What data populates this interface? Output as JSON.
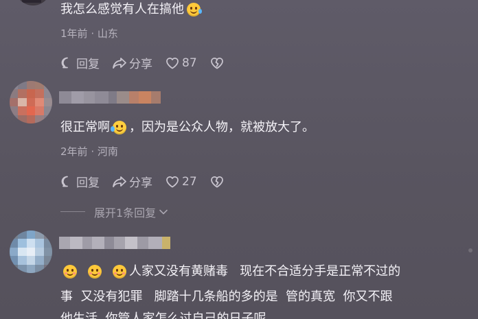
{
  "comments": [
    {
      "text": "我怎么感觉有人在搞他",
      "time": "1年前",
      "location": "山东",
      "reply_label": "回复",
      "share_label": "分享",
      "likes": "87"
    },
    {
      "text_before": "很正常啊",
      "text_after": "，因为是公众人物，就被放大了。",
      "time": "2年前",
      "location": "河南",
      "reply_label": "回复",
      "share_label": "分享",
      "likes": "27",
      "expand_label": "展开1条回复"
    },
    {
      "line1": "人家又没有黄赌毒   现在不合适分手是正常不过的",
      "line2": "事  又没有犯罪   脚踏十几条船的多的是  管的真宽  你又不跟",
      "line3": "他生活  你管人家怎么过自己的日子呢"
    }
  ],
  "separator": "·",
  "icons": {
    "reply": "reply-bubble-icon",
    "share": "share-arrow-icon",
    "like": "heart-outline-icon",
    "dislike": "broken-heart-icon",
    "expand": "chevron-down-icon"
  },
  "colors": {
    "background": "#5d5966",
    "text": "#f4f2f7",
    "meta": "#b7b3be"
  }
}
